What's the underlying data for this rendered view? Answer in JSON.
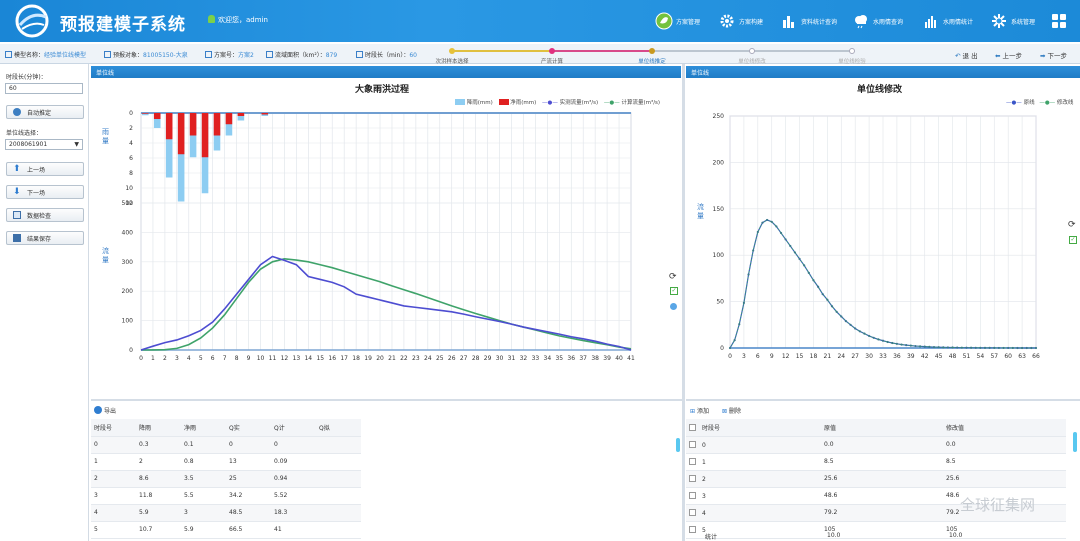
{
  "app": {
    "title": "预报建模子系统",
    "user": "欢迎您，admin"
  },
  "nav": [
    {
      "label": "方案管理",
      "icon": "leaf-icon"
    },
    {
      "label": "方案构建",
      "icon": "gear-icon"
    },
    {
      "label": "资料统计查询",
      "icon": "bar-chart-icon"
    },
    {
      "label": "水雨情查询",
      "icon": "cloud-rain-icon"
    },
    {
      "label": "水雨情统计",
      "icon": "stats-icon"
    },
    {
      "label": "系统管理",
      "icon": "settings-icon"
    }
  ],
  "crumb": {
    "model_label": "模型名称：",
    "model": "经验单位线模型",
    "obj_label": "预报对象：",
    "obj": "81005150-大泉",
    "plan_label": "方案号：",
    "plan": "方案2",
    "area_label": "流域面积（km²）：",
    "area": "879",
    "step_label": "时段长（min）：",
    "step": "60"
  },
  "steps": [
    "次洪样本选择",
    "产流计算",
    "单位线推定",
    "单位线修改",
    "单位线检验"
  ],
  "actions": {
    "exit": "退 出",
    "prev": "上一步",
    "next": "下一步"
  },
  "left": {
    "step_label": "时段长(分钟)：",
    "step_value": "60",
    "auto_btn": "自动推定",
    "sel_label": "单位线选择：",
    "sel_value": "2008061901",
    "up_btn": "上一场",
    "down_btn": "下一场",
    "check_btn": "数据检查",
    "save_btn": "结果保存"
  },
  "panel1": {
    "header": "单位线",
    "export": "导出"
  },
  "panel2": {
    "header": "单位线",
    "add": "添加",
    "del": "删除"
  },
  "chart1": {
    "title": "大象雨洪过程",
    "ylabel_rain": "雨量",
    "ylabel_flow": "流量",
    "legend": [
      "降雨(mm)",
      "净雨(mm)",
      "实测流量(m³/s)",
      "计算流量(m³/s)"
    ],
    "colors": {
      "rain": "#8dcdf2",
      "net": "#e02020",
      "obs": "#4d4dd1",
      "calc": "#3fa36a"
    }
  },
  "chart2": {
    "title": "单位线修改",
    "ylabel": "流量",
    "legend": [
      "原线",
      "修改线"
    ]
  },
  "chart_data": [
    {
      "type": "bar+line",
      "title": "大象雨洪过程",
      "x": [
        0,
        1,
        2,
        3,
        4,
        5,
        6,
        7,
        8,
        9,
        10,
        11,
        12,
        13,
        14,
        15,
        16,
        17,
        18,
        19,
        20,
        21,
        22,
        23,
        24,
        25,
        26,
        27,
        28,
        29,
        30,
        31,
        32,
        33,
        34,
        35,
        36,
        37,
        38,
        39,
        40,
        41
      ],
      "rain_ylim": [
        0,
        12
      ],
      "rain_ticks": [
        "0",
        "2",
        "4",
        "6",
        "8",
        "10",
        "12"
      ],
      "flow_ylim": [
        0,
        500
      ],
      "flow_ticks": [
        "0",
        "100",
        "200",
        "300",
        "400",
        "500"
      ],
      "series": [
        {
          "name": "降雨(mm)",
          "values": [
            0.3,
            2,
            8.6,
            11.8,
            5.9,
            10.7,
            5,
            3,
            1,
            0,
            0.4
          ]
        },
        {
          "name": "净雨(mm)",
          "values": [
            0.1,
            0.8,
            3.5,
            5.5,
            3,
            5.9,
            3,
            1.5,
            0.4,
            0,
            0.2
          ]
        },
        {
          "name": "实测流量(m³/s)",
          "values": [
            0,
            13,
            25,
            34.2,
            48.5,
            66.5,
            95,
            140,
            190,
            240,
            290,
            318,
            305,
            290,
            250,
            240,
            230,
            215,
            190,
            180,
            170,
            160,
            150,
            145,
            140,
            135,
            130,
            122,
            113,
            105,
            97,
            88,
            78,
            70,
            62,
            54,
            45,
            38,
            30,
            20,
            12,
            0
          ]
        },
        {
          "name": "计算流量(m³/s)",
          "values": [
            0,
            0.09,
            0.94,
            5.52,
            18.3,
            41,
            75,
            120,
            175,
            230,
            275,
            300,
            310,
            306,
            300,
            290,
            280,
            268,
            256,
            244,
            232,
            218,
            205,
            192,
            178,
            164,
            150,
            137,
            124,
            112,
            100,
            88,
            78,
            68,
            58,
            48,
            40,
            32,
            25,
            18,
            10,
            4
          ]
        }
      ]
    },
    {
      "type": "line",
      "title": "单位线修改",
      "x_ticks": [
        "0",
        "3",
        "6",
        "9",
        "12",
        "15",
        "18",
        "21",
        "24",
        "27",
        "30",
        "33",
        "36",
        "39",
        "42",
        "45",
        "48",
        "51",
        "54",
        "57",
        "60",
        "63",
        "66"
      ],
      "ylim": [
        0,
        250
      ],
      "y_ticks": [
        "0",
        "50",
        "100",
        "150",
        "200",
        "250"
      ],
      "series": [
        {
          "name": "原线",
          "values": [
            0,
            8.5,
            25.6,
            48.6,
            79.2,
            105,
            125,
            135,
            138,
            136,
            131,
            124,
            117,
            110,
            103,
            96,
            89,
            81,
            73,
            66,
            58,
            52,
            45,
            39,
            34,
            29,
            25,
            21,
            18,
            15.5,
            13,
            11,
            9.3,
            7.8,
            6.5,
            5.4,
            4.5,
            3.7,
            3.1,
            2.6,
            2.1,
            1.8,
            1.5,
            1.2,
            1,
            0.85,
            0.7,
            0.6,
            0.5,
            0.42,
            0.35,
            0.3,
            0.25,
            0.2,
            0.17,
            0.14,
            0.12,
            0.1,
            0.08,
            0.07,
            0.06,
            0.05,
            0.04,
            0.03,
            0.02,
            0.01,
            0
          ]
        },
        {
          "name": "修改线",
          "values": [
            0,
            8.5,
            25.6,
            48.6,
            79.2,
            105,
            125,
            135,
            138,
            136,
            131,
            124,
            117,
            110,
            103,
            96,
            89,
            81,
            73,
            66,
            58,
            52,
            45,
            39,
            34,
            29,
            25,
            21,
            18,
            15.5,
            13,
            11,
            9.3,
            7.8,
            6.5,
            5.4,
            4.5,
            3.7,
            3.1,
            2.6,
            2.1,
            1.8,
            1.5,
            1.2,
            1,
            0.85,
            0.7,
            0.6,
            0.5,
            0.42,
            0.35,
            0.3,
            0.25,
            0.2,
            0.17,
            0.14,
            0.12,
            0.1,
            0.08,
            0.07,
            0.06,
            0.05,
            0.04,
            0.03,
            0.02,
            0.01,
            0
          ]
        }
      ]
    }
  ],
  "table1": {
    "headers": [
      "时段号",
      "降雨",
      "净雨",
      "Q实",
      "Q计",
      "Q拟"
    ],
    "rows": [
      [
        "0",
        "0.3",
        "0.1",
        "0",
        "0",
        ""
      ],
      [
        "1",
        "2",
        "0.8",
        "13",
        "0.09",
        ""
      ],
      [
        "2",
        "8.6",
        "3.5",
        "25",
        "0.94",
        ""
      ],
      [
        "3",
        "11.8",
        "5.5",
        "34.2",
        "5.52",
        ""
      ],
      [
        "4",
        "5.9",
        "3",
        "48.5",
        "18.3",
        ""
      ],
      [
        "5",
        "10.7",
        "5.9",
        "66.5",
        "41",
        ""
      ]
    ]
  },
  "table2": {
    "headers": [
      "时段号",
      "原值",
      "修改值"
    ],
    "rows": [
      [
        "0",
        "0.0",
        "0.0"
      ],
      [
        "1",
        "8.5",
        "8.5"
      ],
      [
        "2",
        "25.6",
        "25.6"
      ],
      [
        "3",
        "48.6",
        "48.6"
      ],
      [
        "4",
        "79.2",
        "79.2"
      ],
      [
        "5",
        "105",
        "105"
      ]
    ],
    "sum_label": "统计",
    "sum": [
      "10.0",
      "10.0"
    ]
  },
  "watermark": "全球征集网"
}
